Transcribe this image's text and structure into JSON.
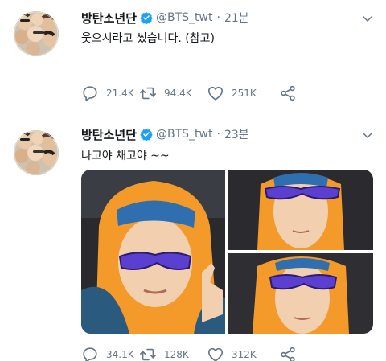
{
  "colors": {
    "text": "#14171a",
    "secondary": "#657786",
    "verified": "#1da1f2",
    "divider": "#e1e8ed",
    "hood": "#f39a2a",
    "headband": "#2f6fb0",
    "sunglasses": "#5b3fd0"
  },
  "tweets": [
    {
      "name": "방탄소년단",
      "handle": "@BTS_twt",
      "separator": "·",
      "time": "21분",
      "text": "웃으시라고 썼습니다. (참고)",
      "icons": {
        "avatar": "group-photo-avatar",
        "verified": "verified-badge-icon",
        "caret": "chevron-down-icon"
      },
      "actions": {
        "reply": {
          "count": "21.4K",
          "icon": "reply-icon"
        },
        "retweet": {
          "count": "94.4K",
          "icon": "retweet-icon"
        },
        "like": {
          "count": "251K",
          "icon": "heart-icon"
        },
        "share": {
          "count": "",
          "icon": "share-icon"
        }
      }
    },
    {
      "name": "방탄소년단",
      "handle": "@BTS_twt",
      "separator": "·",
      "time": "23분",
      "text": "나고야 채고야 ~~",
      "icons": {
        "avatar": "group-photo-avatar",
        "verified": "verified-badge-icon",
        "caret": "chevron-down-icon"
      },
      "media": [
        {
          "description_icon": "selfie-photo-headband"
        },
        {
          "description_icon": "selfie-photo-hood-1"
        },
        {
          "description_icon": "selfie-photo-hood-2"
        }
      ],
      "actions": {
        "reply": {
          "count": "34.1K",
          "icon": "reply-icon"
        },
        "retweet": {
          "count": "128K",
          "icon": "retweet-icon"
        },
        "like": {
          "count": "312K",
          "icon": "heart-icon"
        },
        "share": {
          "count": "",
          "icon": "share-icon"
        }
      }
    }
  ]
}
